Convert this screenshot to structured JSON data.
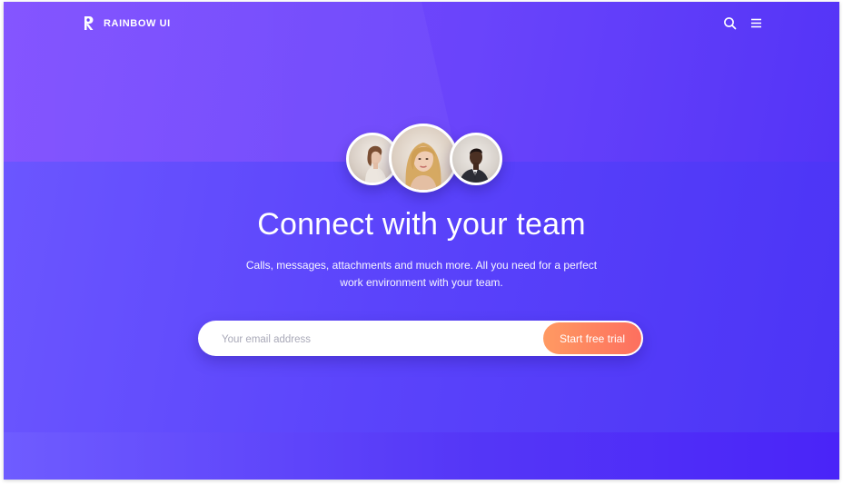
{
  "header": {
    "brand_name": "RAINBOW UI",
    "logo_icon": "rainbow-r-logo",
    "actions": [
      {
        "icon": "search-icon"
      },
      {
        "icon": "hamburger-menu-icon"
      }
    ]
  },
  "hero": {
    "avatars": [
      "woman-profile-photo",
      "blonde-woman-photo",
      "man-profile-photo"
    ],
    "title": "Connect with your team",
    "subtitle_line1": "Calls, messages, attachments and much more. All you need for a perfect",
    "subtitle_line2": "work environment with your team."
  },
  "signup": {
    "email_placeholder": "Your email address",
    "email_value": "",
    "cta_label": "Start free trial"
  },
  "colors": {
    "background_start": "#7a54ff",
    "background_end": "#4f30f5",
    "cta_start": "#ff9a62",
    "cta_end": "#fd6f5f",
    "text": "#ffffff"
  }
}
